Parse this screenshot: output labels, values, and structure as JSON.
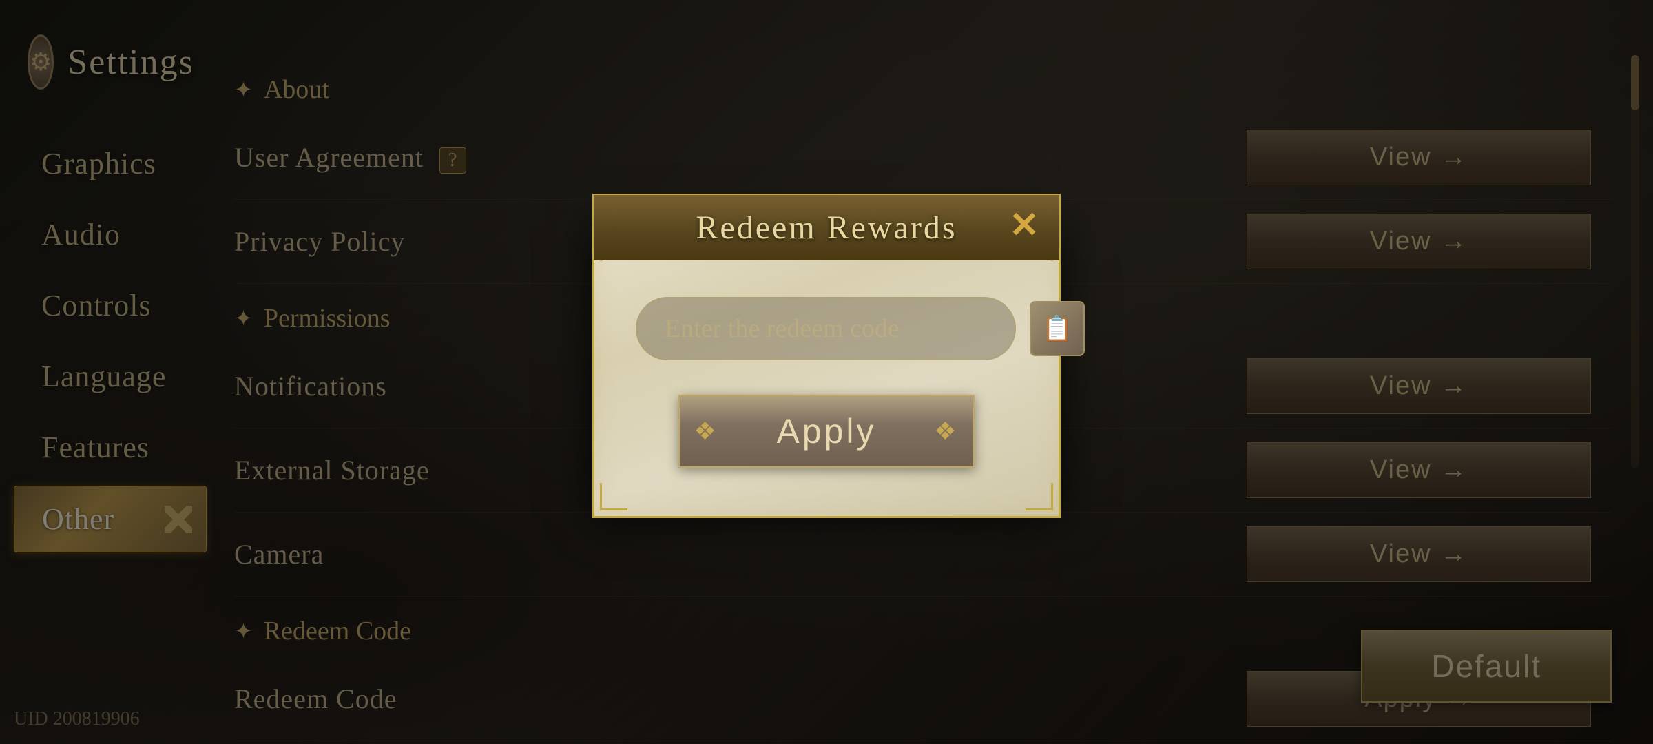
{
  "app": {
    "title": "Settings",
    "uid": "UID 200819906"
  },
  "sidebar": {
    "items": [
      {
        "id": "graphics",
        "label": "Graphics",
        "active": false
      },
      {
        "id": "audio",
        "label": "Audio",
        "active": false
      },
      {
        "id": "controls",
        "label": "Controls",
        "active": false
      },
      {
        "id": "language",
        "label": "Language",
        "active": false
      },
      {
        "id": "features",
        "label": "Features",
        "active": false
      },
      {
        "id": "other",
        "label": "Other",
        "active": true
      }
    ]
  },
  "main": {
    "sections": [
      {
        "header": "About",
        "diamond": true,
        "rows": []
      },
      {
        "header": null,
        "rows": [
          {
            "label": "User Agreement",
            "badge": "?",
            "action": "View →"
          },
          {
            "label": "Privacy Policy",
            "badge": null,
            "action": "View →"
          }
        ]
      },
      {
        "header": "Permissions",
        "diamond": true,
        "rows": []
      },
      {
        "header": null,
        "rows": [
          {
            "label": "Notifications",
            "badge": null,
            "action": "View →"
          },
          {
            "label": "External Storage",
            "badge": null,
            "action": "View →"
          },
          {
            "label": "Camera",
            "badge": null,
            "action": "View →"
          }
        ]
      },
      {
        "header": "Redeem Code",
        "diamond": true,
        "rows": []
      },
      {
        "header": null,
        "rows": [
          {
            "label": "Redeem Code",
            "badge": null,
            "action": "Apply →"
          }
        ]
      }
    ]
  },
  "default_button": {
    "label": "Default"
  },
  "modal": {
    "title": "Redeem Rewards",
    "input_placeholder": "Enter the redeem code",
    "apply_label": "Apply",
    "close_label": "✕"
  }
}
